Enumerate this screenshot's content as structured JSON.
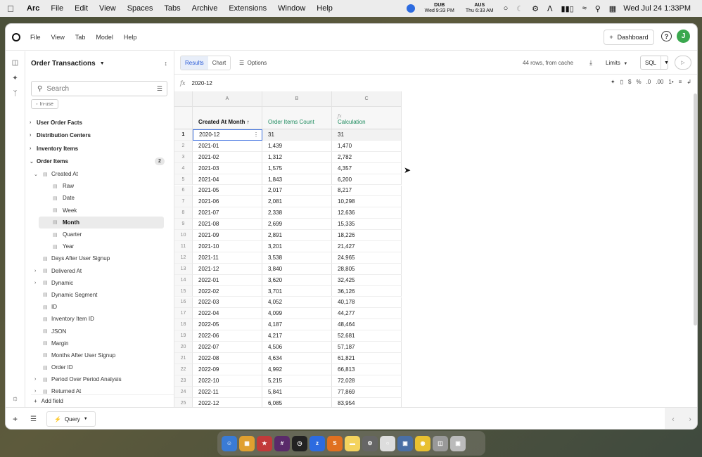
{
  "menubar": {
    "app": "Arc",
    "items": [
      "File",
      "Edit",
      "View",
      "Spaces",
      "Tabs",
      "Archive",
      "Extensions",
      "Window",
      "Help"
    ],
    "clock1": {
      "city": "DUB",
      "time": "Wed 9:33 PM"
    },
    "clock2": {
      "city": "AUS",
      "time": "Thu 6:33 AM"
    },
    "datetime": "Wed Jul 24  1:33PM"
  },
  "topbar": {
    "menus": [
      "File",
      "View",
      "Tab",
      "Model",
      "Help"
    ],
    "dashboard_label": "Dashboard",
    "avatar_initial": "J"
  },
  "sidebar": {
    "title": "Order Transactions",
    "search_placeholder": "Search",
    "inuse_label": "In-use",
    "groups": [
      {
        "label": "User Order Facts"
      },
      {
        "label": "Distribution Centers"
      },
      {
        "label": "Inventory Items"
      },
      {
        "label": "Order Items",
        "count": "2"
      }
    ],
    "fields": [
      {
        "label": "Created At",
        "level": 1,
        "expanded": true
      },
      {
        "label": "Raw",
        "level": 2
      },
      {
        "label": "Date",
        "level": 2
      },
      {
        "label": "Week",
        "level": 2
      },
      {
        "label": "Month",
        "level": 2,
        "selected": true
      },
      {
        "label": "Quarter",
        "level": 2
      },
      {
        "label": "Year",
        "level": 2
      },
      {
        "label": "Days After User Signup",
        "level": 1
      },
      {
        "label": "Delivered At",
        "level": 1,
        "collapsed": true
      },
      {
        "label": "Dynamic",
        "level": 1,
        "collapsed": true
      },
      {
        "label": "Dynamic Segment",
        "level": 1
      },
      {
        "label": "ID",
        "level": 1
      },
      {
        "label": "Inventory Item ID",
        "level": 1
      },
      {
        "label": "JSON",
        "level": 1
      },
      {
        "label": "Margin",
        "level": 1
      },
      {
        "label": "Months After User Signup",
        "level": 1
      },
      {
        "label": "Order ID",
        "level": 1
      },
      {
        "label": "Period Over Period Analysis",
        "level": 1,
        "collapsed": true
      },
      {
        "label": "Returned At",
        "level": 1,
        "collapsed": true
      }
    ],
    "add_field_label": "Add field"
  },
  "toolbar": {
    "tab_results": "Results",
    "tab_chart": "Chart",
    "options": "Options",
    "rows_info": "44 rows, from cache",
    "limits": "Limits",
    "sql": "SQL"
  },
  "formula": {
    "fx": "fx",
    "value": "2020-12"
  },
  "table": {
    "col_letters": [
      "A",
      "B",
      "C"
    ],
    "headers": [
      "Created At Month ↑",
      "Order Items Count",
      "Calculation"
    ],
    "calc_tag": "ƒx",
    "rows": [
      [
        "2020-12",
        "31",
        "31"
      ],
      [
        "2021-01",
        "1,439",
        "1,470"
      ],
      [
        "2021-02",
        "1,312",
        "2,782"
      ],
      [
        "2021-03",
        "1,575",
        "4,357"
      ],
      [
        "2021-04",
        "1,843",
        "6,200"
      ],
      [
        "2021-05",
        "2,017",
        "8,217"
      ],
      [
        "2021-06",
        "2,081",
        "10,298"
      ],
      [
        "2021-07",
        "2,338",
        "12,636"
      ],
      [
        "2021-08",
        "2,699",
        "15,335"
      ],
      [
        "2021-09",
        "2,891",
        "18,226"
      ],
      [
        "2021-10",
        "3,201",
        "21,427"
      ],
      [
        "2021-11",
        "3,538",
        "24,965"
      ],
      [
        "2021-12",
        "3,840",
        "28,805"
      ],
      [
        "2022-01",
        "3,620",
        "32,425"
      ],
      [
        "2022-02",
        "3,701",
        "36,126"
      ],
      [
        "2022-03",
        "4,052",
        "40,178"
      ],
      [
        "2022-04",
        "4,099",
        "44,277"
      ],
      [
        "2022-05",
        "4,187",
        "48,464"
      ],
      [
        "2022-06",
        "4,217",
        "52,681"
      ],
      [
        "2022-07",
        "4,506",
        "57,187"
      ],
      [
        "2022-08",
        "4,634",
        "61,821"
      ],
      [
        "2022-09",
        "4,992",
        "66,813"
      ],
      [
        "2022-10",
        "5,215",
        "72,028"
      ],
      [
        "2022-11",
        "5,841",
        "77,869"
      ],
      [
        "2022-12",
        "6,085",
        "83,954"
      ]
    ]
  },
  "bottom": {
    "query_tab": "Query"
  }
}
